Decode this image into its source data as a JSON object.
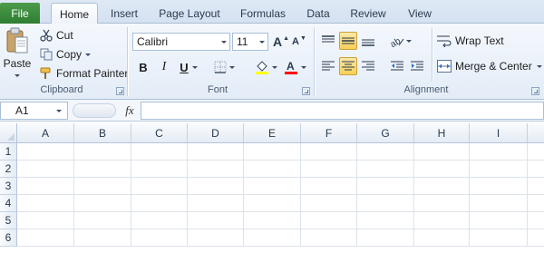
{
  "tabs": {
    "file": "File",
    "items": [
      "Home",
      "Insert",
      "Page Layout",
      "Formulas",
      "Data",
      "Review",
      "View"
    ]
  },
  "clipboard": {
    "paste": "Paste",
    "cut": "Cut",
    "copy": "Copy",
    "format_painter": "Format Painter",
    "group_label": "Clipboard"
  },
  "font": {
    "family": "Calibri",
    "size": "11",
    "bold": "B",
    "italic": "I",
    "underline": "U",
    "grow": "A",
    "shrink": "A",
    "group_label": "Font",
    "fill_color": "#ffff00",
    "font_color": "#ff0000"
  },
  "alignment": {
    "wrap_text": "Wrap Text",
    "merge_center": "Merge & Center",
    "group_label": "Alignment"
  },
  "formula_bar": {
    "name_box": "A1",
    "fx": "fx",
    "value": ""
  },
  "sheet": {
    "columns": [
      "A",
      "B",
      "C",
      "D",
      "E",
      "F",
      "G",
      "H",
      "I"
    ],
    "rows": [
      "1",
      "2",
      "3",
      "4",
      "5",
      "6"
    ]
  },
  "colors": {
    "file_tab": "#3d8d3e",
    "accent": "#f7cf59"
  }
}
